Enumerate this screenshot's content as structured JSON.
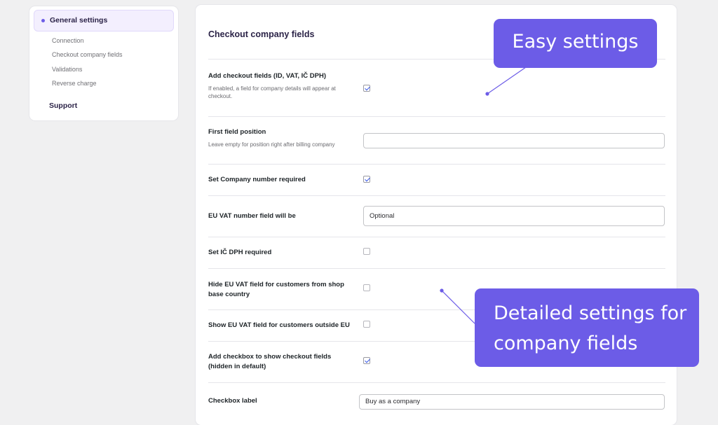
{
  "sidebar": {
    "active_item": "General settings",
    "sub_items": [
      "Connection",
      "Checkout company fields",
      "Validations",
      "Reverse charge"
    ],
    "support": "Support"
  },
  "main": {
    "title": "Checkout company fields",
    "rows": [
      {
        "label": "Add checkout fields (ID, VAT, IČ DPH)",
        "description": "If enabled, a field for company details will appear at checkout.",
        "checked": true
      },
      {
        "label": "First field position",
        "description": "Leave empty for position right after billing company",
        "value": ""
      },
      {
        "label": "Set Company number required",
        "checked": true
      },
      {
        "label": "EU VAT number field will be",
        "value": "Optional"
      },
      {
        "label": "Set IČ DPH required",
        "checked": false
      },
      {
        "label": "Hide EU VAT field for customers from shop base country",
        "checked": false
      },
      {
        "label": "Show EU VAT field for customers outside EU",
        "checked": false
      },
      {
        "label": "Add checkbox to show checkout fields (hidden in default)",
        "checked": true
      },
      {
        "label": "Checkbox label",
        "value": "Buy as a company"
      }
    ]
  },
  "callouts": {
    "easy": "Easy settings",
    "detailed": "Detailed settings for company fields"
  },
  "colors": {
    "accent": "#6c5ce7",
    "checkmark": "#3858e9",
    "background": "#f0f0f1"
  }
}
